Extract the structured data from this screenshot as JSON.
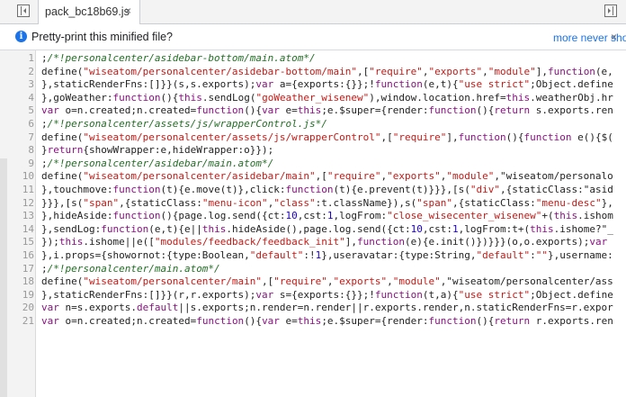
{
  "tab": {
    "title": "pack_bc18b69.js",
    "close_glyph": "×"
  },
  "infobar": {
    "message": "Pretty-print this minified file?",
    "link_pretty": "",
    "link_more": "more never show",
    "close_glyph": "×"
  },
  "editor": {
    "lines": [
      {
        "n": "1",
        "text": ";/*!personalcenter/asidebar-bottom/main.atom*/"
      },
      {
        "n": "2",
        "text": "define(\"wiseatom/personalcenter/asidebar-bottom/main\",[\"require\",\"exports\",\"module\"],function(e,"
      },
      {
        "n": "3",
        "text": "},staticRenderFns:[]}}(s,s.exports);var a={exports:{}};!function(e,t){\"use strict\";Object.define"
      },
      {
        "n": "4",
        "text": "},goWeather:function(){this.sendLog(\"goWeather_wisenew\"),window.location.href=this.weatherObj.hr"
      },
      {
        "n": "5",
        "text": "var o=n.created;n.created=function(){var e=this;e.$super={render:function(){return s.exports.ren"
      },
      {
        "n": "6",
        "text": ";/*!personalcenter/assets/js/wrapperControl.js*/"
      },
      {
        "n": "7",
        "text": "define(\"wiseatom/personalcenter/assets/js/wrapperControl\",[\"require\"],function(){function e(){$("
      },
      {
        "n": "8",
        "text": "}return{showWrapper:e,hideWrapper:o}});"
      },
      {
        "n": "9",
        "text": ";/*!personalcenter/asidebar/main.atom*/"
      },
      {
        "n": "10",
        "text": "define(\"wiseatom/personalcenter/asidebar/main\",[\"require\",\"exports\",\"module\",\"wiseatom/personalo"
      },
      {
        "n": "11",
        "text": "},touchmove:function(t){e.move(t)},click:function(t){e.prevent(t)}}},[s(\"div\",{staticClass:\"asid"
      },
      {
        "n": "12",
        "text": "}}},[s(\"span\",{staticClass:\"menu-icon\",\"class\":t.className}),s(\"span\",{staticClass:\"menu-desc\"},"
      },
      {
        "n": "13",
        "text": "},hideAside:function(){page.log.send({ct:10,cst:1,logFrom:\"close_wisecenter_wisenew\"+(this.ishom"
      },
      {
        "n": "14",
        "text": "},sendLog:function(e,t){e||this.hideAside(),page.log.send({ct:10,cst:1,logFrom:t+(this.ishome?\"_"
      },
      {
        "n": "15",
        "text": "});this.ishome||e([\"modules/feedback/feedback_init\"],function(e){e.init()})}}}(o,o.exports);var"
      },
      {
        "n": "16",
        "text": "},i.props={showornot:{type:Boolean,\"default\":!1},useravatar:{type:String,\"default\":\"\"},username:"
      },
      {
        "n": "17",
        "text": ";/*!personalcenter/main.atom*/"
      },
      {
        "n": "18",
        "text": "define(\"wiseatom/personalcenter/main\",[\"require\",\"exports\",\"module\",\"wiseatom/personalcenter/ass"
      },
      {
        "n": "19",
        "text": "},staticRenderFns:[]}}(r,r.exports);var s={exports:{}};!function(t,a){\"use strict\";Object.define"
      },
      {
        "n": "20",
        "text": "var n=s.exports.default||s.exports;n.render=n.render||r.exports.render,n.staticRenderFns=r.expor"
      },
      {
        "n": "21",
        "text": "var o=n.created;n.created=function(){var e=this;e.$super={render:function(){return r.exports.ren"
      }
    ]
  }
}
